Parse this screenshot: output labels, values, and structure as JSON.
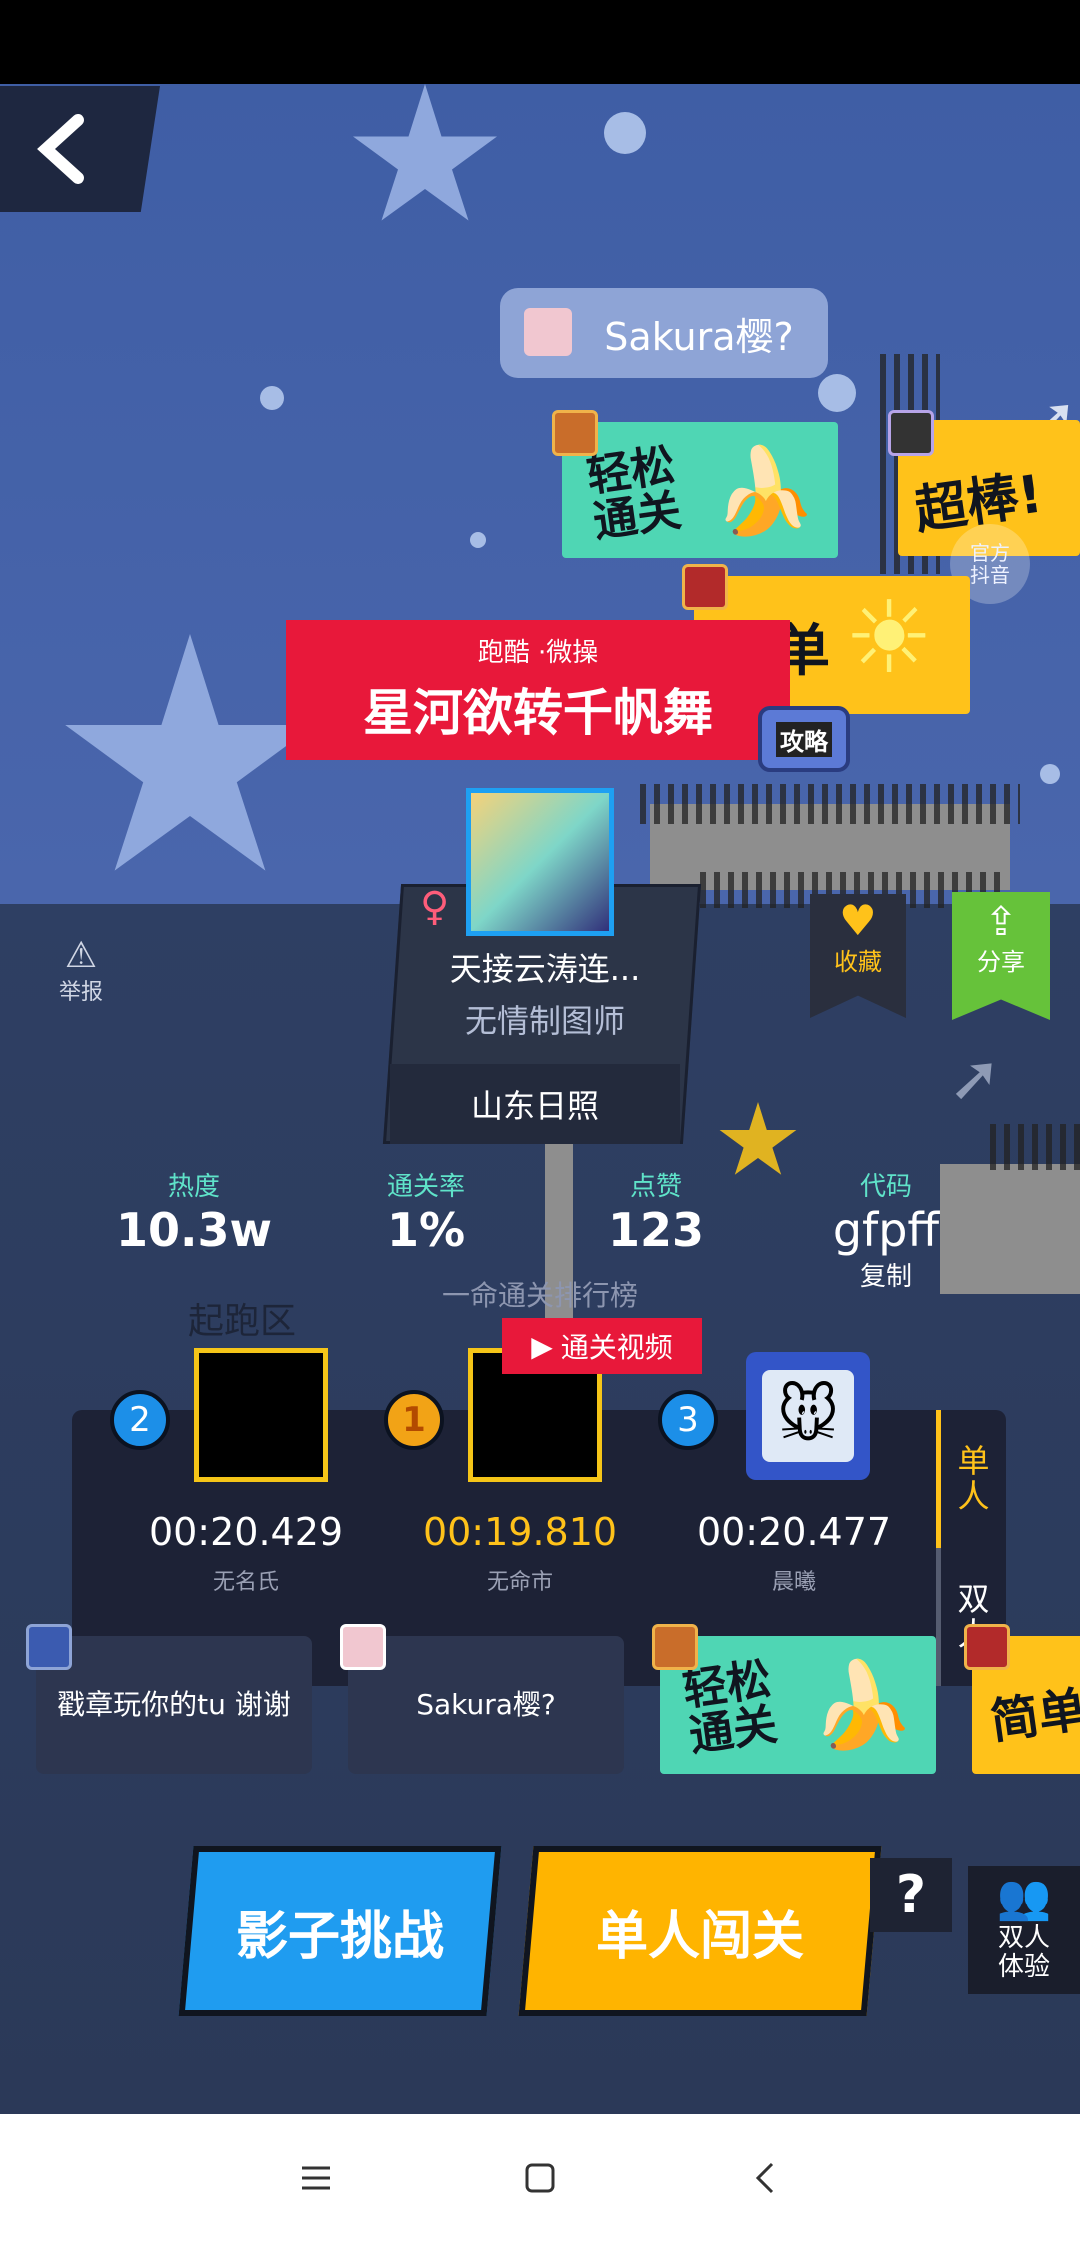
{
  "level": {
    "category": "跑酷 ·微操",
    "title": "星河欲转千帆舞",
    "level_name": "天接云涛连...",
    "author": "无情制图师",
    "location": "山东日照"
  },
  "actions": {
    "report": "举报",
    "favorite": "收藏",
    "share": "分享",
    "official_douyin": "官方抖音",
    "guide": "攻略"
  },
  "stickers": {
    "top_comment": "Sakura樱?",
    "easy_pass": "轻松通关",
    "great": "超棒!",
    "simple_partial": "单",
    "simple_bottom": "简单"
  },
  "stats": [
    {
      "label": "热度",
      "value": "10.3w"
    },
    {
      "label": "通关率",
      "value": "1%"
    },
    {
      "label": "点赞",
      "value": "123"
    },
    {
      "label": "代码",
      "value": "gfpff",
      "sub": "复制"
    }
  ],
  "background_text": "起跑区",
  "leaderboard": {
    "title": "一命通关排行榜",
    "video_label": "通关视频",
    "entries": [
      {
        "rank": "2",
        "time": "00:20.429",
        "name": "无名氏"
      },
      {
        "rank": "1",
        "time": "00:19.810",
        "name": "无命市"
      },
      {
        "rank": "3",
        "time": "00:20.477",
        "name": "晨曦"
      }
    ],
    "tabs": [
      "单人",
      "双人"
    ]
  },
  "comments": [
    {
      "text": "戳章玩你的tu 谢谢"
    },
    {
      "text": "Sakura樱?"
    },
    {
      "text": "轻松通关"
    },
    {
      "text": "简单"
    }
  ],
  "buttons": {
    "shadow_challenge": "影子挑战",
    "solo_play": "单人闯关",
    "help": "?",
    "duo_trial": "双人体验"
  },
  "colors": {
    "sky": "#4a66ac",
    "ground": "#2b3958",
    "accent_yellow": "#ffb400",
    "accent_blue": "#1f9cf0",
    "teal": "#4fd6b4",
    "red_banner": "#e8183a",
    "share_green": "#66c23a"
  }
}
